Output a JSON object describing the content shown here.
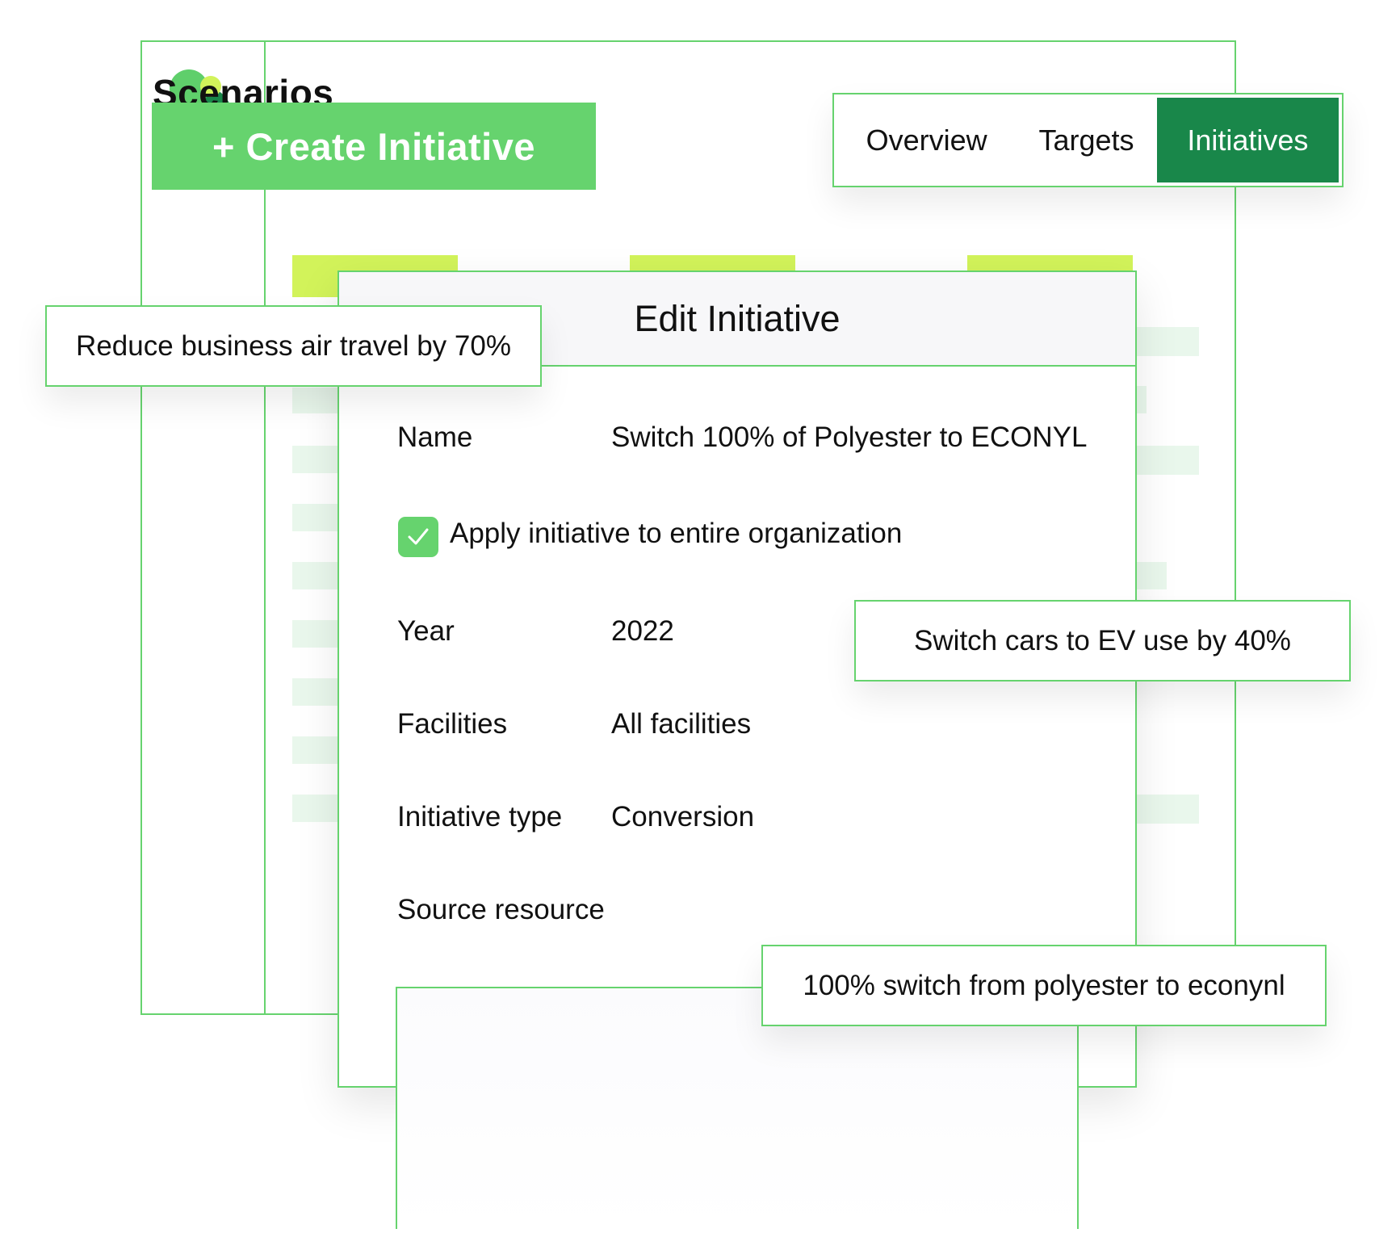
{
  "app": {
    "title": "Scenarios",
    "create_button": "+ Create Initiative"
  },
  "tabs": [
    {
      "label": "Overview",
      "active": false
    },
    {
      "label": "Targets",
      "active": false
    },
    {
      "label": "Initiatives",
      "active": true
    }
  ],
  "dialog": {
    "title": "Edit Initiative",
    "name_label": "Name",
    "name_value": "Switch 100% of Polyester to ECONYL",
    "apply_label": "Apply initiative to entire organization",
    "apply_checked": true,
    "year_label": "Year",
    "year_value": "2022",
    "facilities_label": "Facilities",
    "facilities_value": "All facilities",
    "type_label": "Initiative type",
    "type_value": "Conversion",
    "source_label": "Source resource"
  },
  "callouts": {
    "air": "Reduce business air travel by 70%",
    "ev": "Switch cars to EV use by 40%",
    "econyl": "100% switch from polyester to econynl"
  },
  "colors": {
    "accent_green": "#66d36e",
    "dark_green": "#19874a",
    "lime": "#d2f35a"
  }
}
